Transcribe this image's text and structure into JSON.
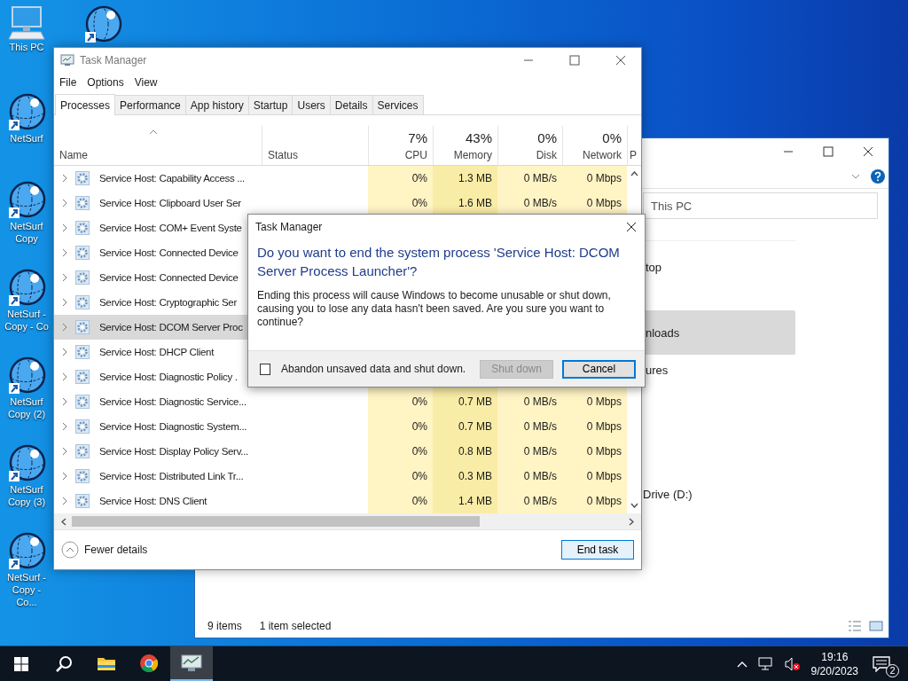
{
  "desktop": {
    "icons": [
      {
        "kind": "computer",
        "label": "This PC"
      },
      {
        "kind": "globe",
        "label": "NetSurf"
      },
      {
        "kind": "globe",
        "label": "NetSurf Copy"
      },
      {
        "kind": "globe",
        "label": "NetSurf - Copy - Co"
      },
      {
        "kind": "globe",
        "label": "NetSurf Copy (2)"
      },
      {
        "kind": "globe",
        "label": "NetSurf Copy (3)"
      },
      {
        "kind": "globe",
        "label": "NetSurf - Copy - Co..."
      }
    ],
    "top_icon": {
      "kind": "globe"
    }
  },
  "explorer": {
    "address": "This PC",
    "nav_items": [
      {
        "label": "top",
        "selected": false
      },
      {
        "label": "nloads",
        "selected": true
      },
      {
        "label": "ures",
        "selected": false
      }
    ],
    "drive": "Drive (D:)",
    "status": [
      "9 items",
      "1 item selected"
    ]
  },
  "task_manager": {
    "title": "Task Manager",
    "menu": [
      "File",
      "Options",
      "View"
    ],
    "tabs": [
      {
        "label": "Processes",
        "selected": true
      },
      {
        "label": "Performance",
        "selected": false
      },
      {
        "label": "App history",
        "selected": false
      },
      {
        "label": "Startup",
        "selected": false
      },
      {
        "label": "Users",
        "selected": false
      },
      {
        "label": "Details",
        "selected": false
      },
      {
        "label": "Services",
        "selected": false
      }
    ],
    "columns": [
      {
        "label": "Name"
      },
      {
        "label": "Status"
      },
      {
        "label": "CPU",
        "usage": "7%"
      },
      {
        "label": "Memory",
        "usage": "43%"
      },
      {
        "label": "Disk",
        "usage": "0%"
      },
      {
        "label": "Network",
        "usage": "0%"
      },
      {
        "label": "P"
      }
    ],
    "rows": [
      {
        "name": "Service Host: Capability Access ...",
        "selected": false,
        "cpu": "0%",
        "memory": "1.3 MB",
        "disk": "0 MB/s",
        "network": "0 Mbps"
      },
      {
        "name": "Service Host: Clipboard User Ser",
        "selected": false,
        "cpu": "0%",
        "memory": "1.6 MB",
        "disk": "0 MB/s",
        "network": "0 Mbps"
      },
      {
        "name": "Service Host: COM+ Event Syste",
        "selected": false
      },
      {
        "name": "Service Host: Connected Device",
        "selected": false
      },
      {
        "name": "Service Host: Connected Device",
        "selected": false
      },
      {
        "name": "Service Host: Cryptographic Ser",
        "selected": false
      },
      {
        "name": "Service Host: DCOM Server Proc",
        "selected": true
      },
      {
        "name": "Service Host: DHCP Client",
        "selected": false
      },
      {
        "name": "Service Host: Diagnostic Policy .",
        "selected": false
      },
      {
        "name": "Service Host: Diagnostic Service...",
        "selected": false,
        "cpu": "0%",
        "memory": "0.7 MB",
        "disk": "0 MB/s",
        "network": "0 Mbps"
      },
      {
        "name": "Service Host: Diagnostic System...",
        "selected": false,
        "cpu": "0%",
        "memory": "0.7 MB",
        "disk": "0 MB/s",
        "network": "0 Mbps"
      },
      {
        "name": "Service Host: Display Policy Serv...",
        "selected": false,
        "cpu": "0%",
        "memory": "0.8 MB",
        "disk": "0 MB/s",
        "network": "0 Mbps"
      },
      {
        "name": "Service Host: Distributed Link Tr...",
        "selected": false,
        "cpu": "0%",
        "memory": "0.3 MB",
        "disk": "0 MB/s",
        "network": "0 Mbps"
      },
      {
        "name": "Service Host: DNS Client",
        "selected": false,
        "cpu": "0%",
        "memory": "1.4 MB",
        "disk": "0 MB/s",
        "network": "0 Mbps"
      }
    ],
    "fewer_details": "Fewer details",
    "end_task": "End task"
  },
  "dialog": {
    "title": "Task Manager",
    "heading": "Do you want to end the system process 'Service Host: DCOM Server Process Launcher'?",
    "message": "Ending this process will cause Windows to become unusable or shut down, causing you to lose any data hasn't been saved. Are you sure you want to continue?",
    "checkbox": {
      "label": "Abandon unsaved data and shut down.",
      "checked": false
    },
    "buttons": [
      {
        "label": "Shut down",
        "disabled": true
      },
      {
        "label": "Cancel",
        "disabled": false
      }
    ]
  },
  "taskbar": {
    "apps": [
      {
        "kind": "folder",
        "active": false
      },
      {
        "kind": "browser",
        "active": false
      },
      {
        "kind": "taskmgr",
        "active": true
      }
    ],
    "time": "19:16",
    "date": "9/20/2023",
    "notifications": "2"
  }
}
